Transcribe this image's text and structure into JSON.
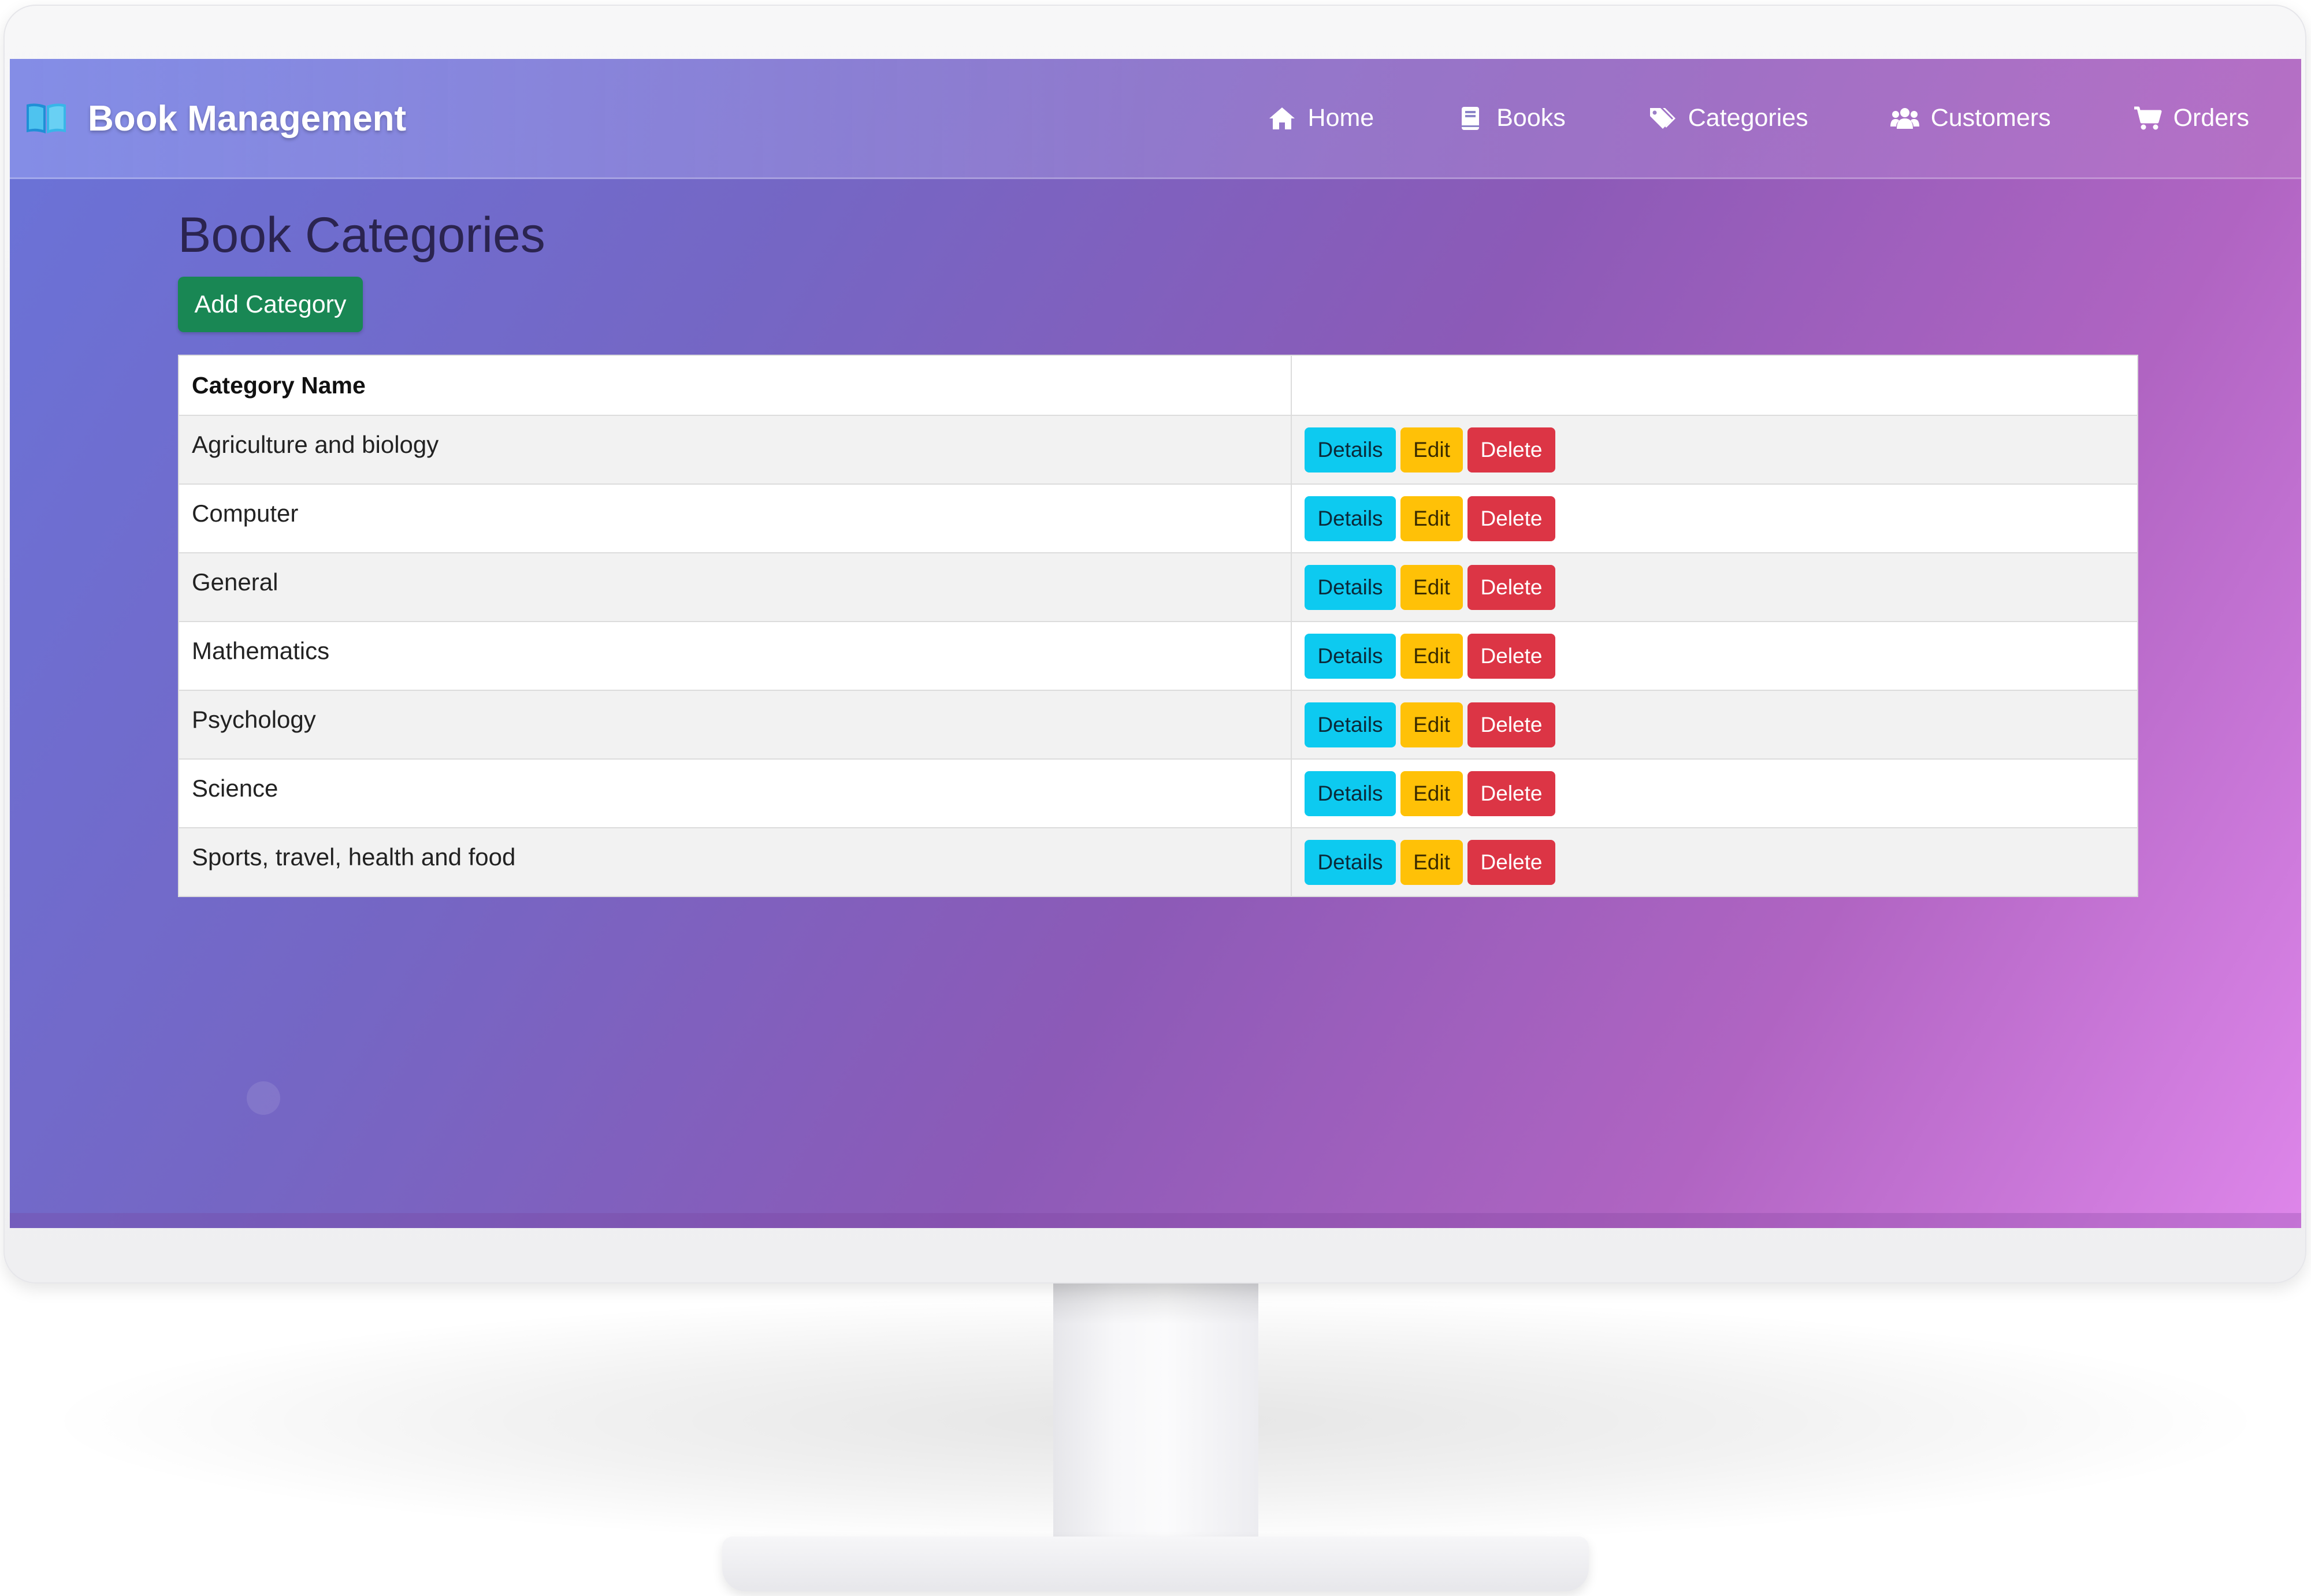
{
  "brand": {
    "title": "Book Management"
  },
  "nav": {
    "items": [
      {
        "label": "Home",
        "icon": "home-icon"
      },
      {
        "label": "Books",
        "icon": "book-icon"
      },
      {
        "label": "Categories",
        "icon": "tags-icon"
      },
      {
        "label": "Customers",
        "icon": "users-icon"
      },
      {
        "label": "Orders",
        "icon": "cart-icon"
      }
    ]
  },
  "page": {
    "title": "Book Categories",
    "add_button_label": "Add Category"
  },
  "table": {
    "headers": [
      "Category Name",
      ""
    ],
    "action_labels": {
      "details": "Details",
      "edit": "Edit",
      "delete": "Delete"
    },
    "rows": [
      "Agriculture and biology",
      "Computer",
      "General",
      "Mathematics",
      "Psychology",
      "Science",
      "Sports, travel, health and food"
    ]
  },
  "colors": {
    "add_button": "#198754",
    "details_button": "#0dcaf0",
    "edit_button": "#ffc107",
    "delete_button": "#dc3545"
  }
}
